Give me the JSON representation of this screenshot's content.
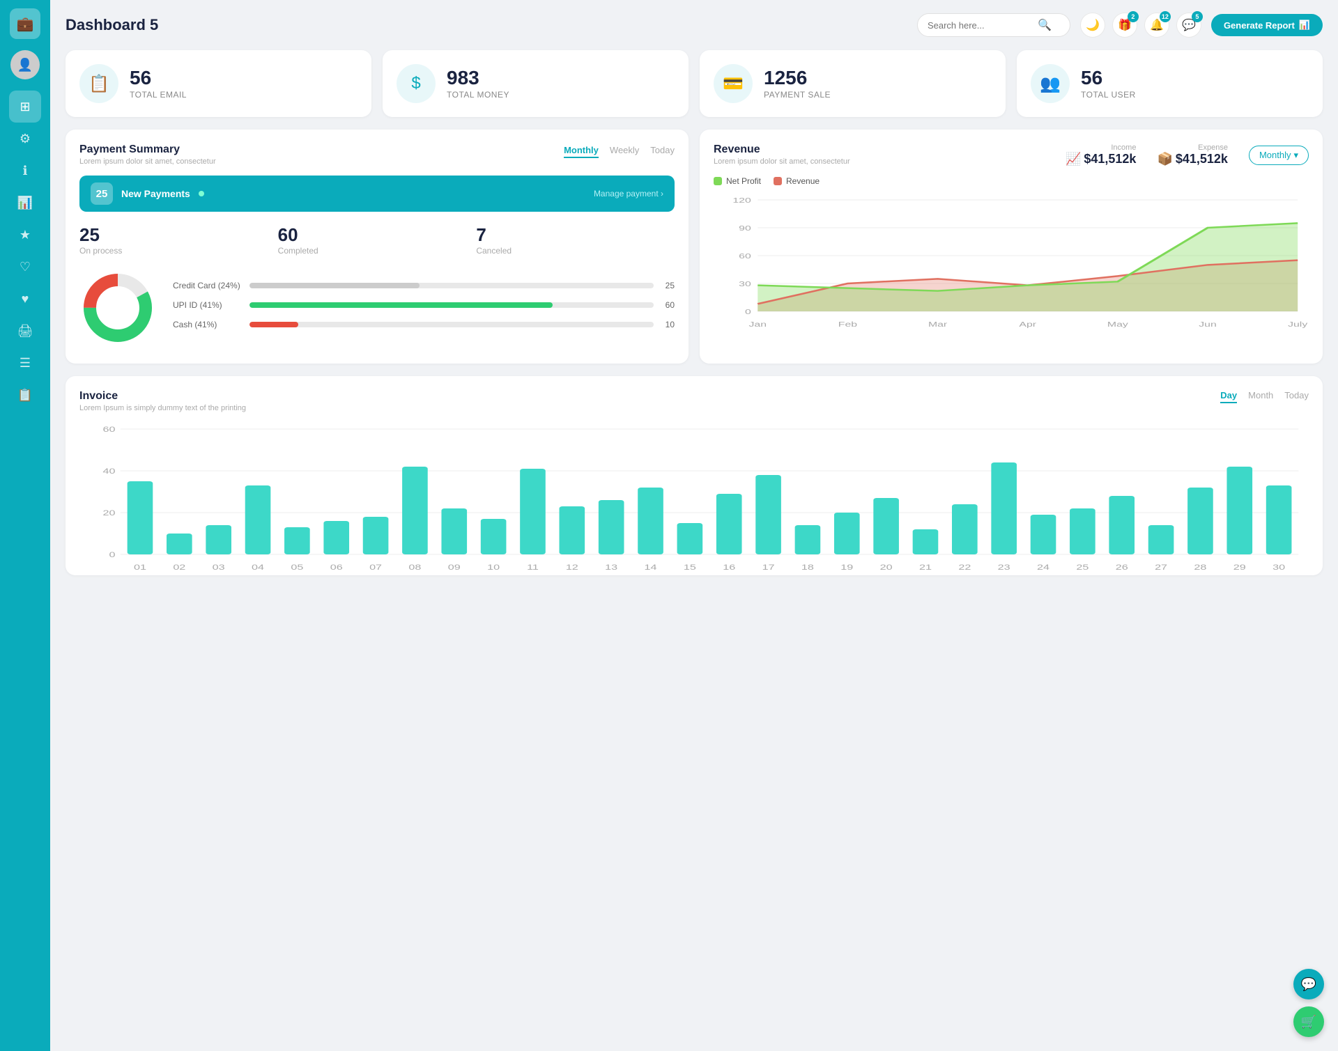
{
  "sidebar": {
    "logo_icon": "💼",
    "items": [
      {
        "id": "dashboard",
        "icon": "⊞",
        "active": true
      },
      {
        "id": "settings",
        "icon": "⚙"
      },
      {
        "id": "info",
        "icon": "ℹ"
      },
      {
        "id": "analytics",
        "icon": "📊"
      },
      {
        "id": "star",
        "icon": "★"
      },
      {
        "id": "heart-outline",
        "icon": "♡"
      },
      {
        "id": "heart-filled",
        "icon": "♥"
      },
      {
        "id": "print",
        "icon": "🖨"
      },
      {
        "id": "list",
        "icon": "☰"
      },
      {
        "id": "document",
        "icon": "📋"
      }
    ]
  },
  "topbar": {
    "title": "Dashboard 5",
    "search_placeholder": "Search here...",
    "generate_report": "Generate Report",
    "icons": [
      {
        "id": "moon",
        "icon": "🌙",
        "badge": null
      },
      {
        "id": "gift",
        "icon": "🎁",
        "badge": "2"
      },
      {
        "id": "bell",
        "icon": "🔔",
        "badge": "12"
      },
      {
        "id": "chat",
        "icon": "💬",
        "badge": "5"
      }
    ]
  },
  "stats": [
    {
      "id": "email",
      "icon": "📋",
      "num": "56",
      "label": "TOTAL EMAIL"
    },
    {
      "id": "money",
      "icon": "$",
      "num": "983",
      "label": "TOTAL MONEY"
    },
    {
      "id": "payment",
      "icon": "💳",
      "num": "1256",
      "label": "PAYMENT SALE"
    },
    {
      "id": "users",
      "icon": "👥",
      "num": "56",
      "label": "TOTAL USER"
    }
  ],
  "payment_summary": {
    "title": "Payment Summary",
    "subtitle": "Lorem ipsum dolor sit amet, consectetur",
    "tabs": [
      "Monthly",
      "Weekly",
      "Today"
    ],
    "active_tab": "Monthly",
    "new_payments": {
      "count": "25",
      "label": "New Payments",
      "link": "Manage payment ›"
    },
    "stats": [
      {
        "num": "25",
        "label": "On process"
      },
      {
        "num": "60",
        "label": "Completed"
      },
      {
        "num": "7",
        "label": "Canceled"
      }
    ],
    "progress_items": [
      {
        "label": "Credit Card (24%)",
        "pct": 42,
        "val": "25",
        "color": "#ccc"
      },
      {
        "label": "UPI ID (41%)",
        "pct": 75,
        "val": "60",
        "color": "#2ecc71"
      },
      {
        "label": "Cash (41%)",
        "pct": 12,
        "val": "10",
        "color": "#e74c3c"
      }
    ],
    "donut": {
      "segments": [
        {
          "pct": 17,
          "color": "#ccc"
        },
        {
          "pct": 58,
          "color": "#2ecc71"
        },
        {
          "pct": 25,
          "color": "#e74c3c"
        }
      ]
    }
  },
  "revenue": {
    "title": "Revenue",
    "subtitle": "Lorem ipsum dolor sit amet, consectetur",
    "tab": "Monthly",
    "income": {
      "label": "Income",
      "value": "$41,512k",
      "icon": "📈"
    },
    "expense": {
      "label": "Expense",
      "value": "$41,512k",
      "icon": "📦"
    },
    "legend": [
      {
        "label": "Net Profit",
        "color": "#7ed957"
      },
      {
        "label": "Revenue",
        "color": "#e07060"
      }
    ],
    "chart": {
      "labels": [
        "Jan",
        "Feb",
        "Mar",
        "Apr",
        "May",
        "Jun",
        "July"
      ],
      "net_profit": [
        28,
        25,
        22,
        28,
        32,
        90,
        95
      ],
      "revenue": [
        8,
        30,
        35,
        28,
        38,
        50,
        55
      ]
    }
  },
  "invoice": {
    "title": "Invoice",
    "subtitle": "Lorem Ipsum is simply dummy text of the printing",
    "tabs": [
      "Day",
      "Month",
      "Today"
    ],
    "active_tab": "Day",
    "labels": [
      "01",
      "02",
      "03",
      "04",
      "05",
      "06",
      "07",
      "08",
      "09",
      "10",
      "11",
      "12",
      "13",
      "14",
      "15",
      "16",
      "17",
      "18",
      "19",
      "20",
      "21",
      "22",
      "23",
      "24",
      "25",
      "26",
      "27",
      "28",
      "29",
      "30"
    ],
    "values": [
      35,
      10,
      14,
      33,
      13,
      16,
      18,
      42,
      22,
      17,
      41,
      23,
      26,
      32,
      15,
      29,
      38,
      14,
      20,
      27,
      12,
      24,
      44,
      19,
      22,
      28,
      14,
      32,
      42,
      33
    ],
    "y_labels": [
      "0",
      "20",
      "40",
      "60"
    ],
    "bar_color": "#3dd8c8"
  },
  "fab": [
    {
      "id": "support",
      "icon": "💬"
    },
    {
      "id": "cart",
      "icon": "🛒"
    }
  ]
}
